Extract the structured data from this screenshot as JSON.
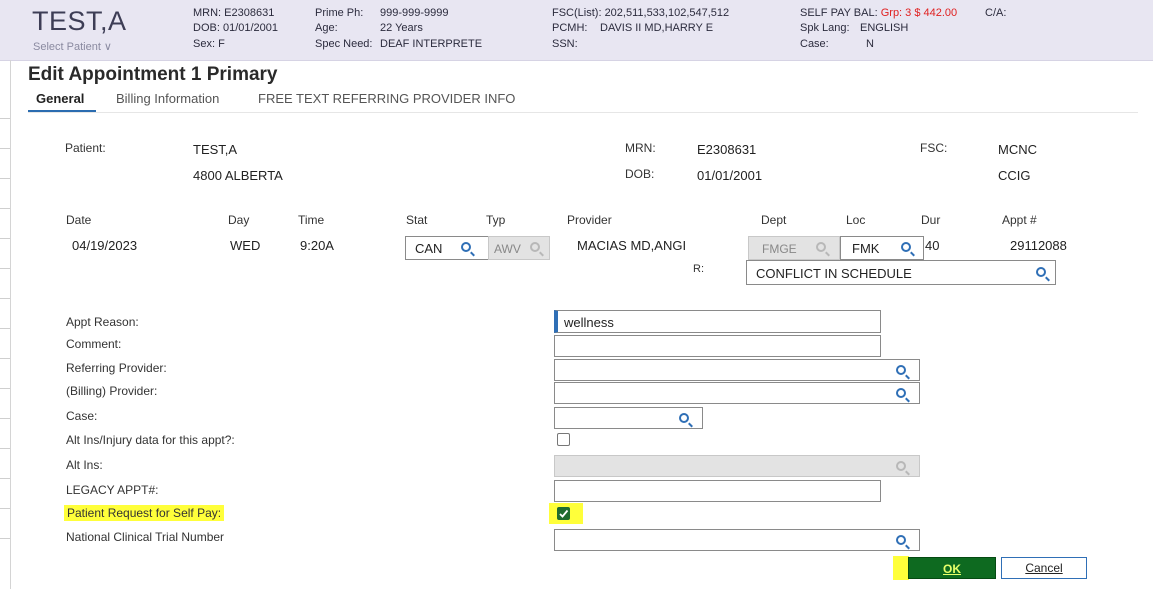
{
  "header": {
    "patient_name": "TEST,A",
    "select_patient": "Select Patient ∨",
    "mrn_label": "MRN:",
    "mrn": "E2308631",
    "dob_label": "DOB:",
    "dob": "01/01/2001",
    "sex_label": "Sex:",
    "sex": "F",
    "prime_ph_label": "Prime Ph:",
    "prime_ph": "999-999-9999",
    "age_label": "Age:",
    "age": "22 Years",
    "spec_need_label": "Spec Need:",
    "spec_need": "DEAF INTERPRETE",
    "fsc_list_label": "FSC(List):",
    "fsc_list": "202,511,533,102,547,512",
    "pcmh_label": "PCMH:",
    "pcmh": "DAVIS II MD,HARRY E",
    "ssn_label": "SSN:",
    "self_pay_label": "SELF PAY BAL:",
    "self_pay_value": "Grp: 3 $ 442.00",
    "spk_lang_label": "Spk Lang:",
    "spk_lang": "ENGLISH",
    "case_label": "Case:",
    "case": "N",
    "ca_label": "C/A:"
  },
  "page": {
    "title": "Edit Appointment 1 Primary",
    "tabs": [
      "General",
      "Billing Information",
      "FREE TEXT REFERRING PROVIDER INFO"
    ]
  },
  "patient": {
    "label": "Patient:",
    "name": "TEST,A",
    "address": "4800 ALBERTA",
    "mrn_label": "MRN:",
    "mrn": "E2308631",
    "dob_label": "DOB:",
    "dob": "01/01/2001",
    "fsc_label": "FSC:",
    "fsc1": "MCNC",
    "fsc2": "CCIG"
  },
  "appt": {
    "headers": {
      "date": "Date",
      "day": "Day",
      "time": "Time",
      "stat": "Stat",
      "typ": "Typ",
      "provider": "Provider",
      "dept": "Dept",
      "loc": "Loc",
      "dur": "Dur",
      "appt": "Appt #"
    },
    "date": "04/19/2023",
    "day": "WED",
    "time": "9:20A",
    "stat": "CAN",
    "typ": "AWV",
    "provider": "MACIAS MD,ANGI",
    "dept": "FMGE",
    "loc": "FMK",
    "dur": "40",
    "appt_no": "29112088",
    "r_label": "R:",
    "reason_code": "CONFLICT IN SCHEDULE"
  },
  "form": {
    "appt_reason_label": "Appt Reason:",
    "appt_reason_value": "wellness",
    "comment_label": "Comment:",
    "referring_label": "Referring Provider:",
    "billing_label": "(Billing) Provider:",
    "case_label": "Case:",
    "alt_ins_injury_label": "Alt Ins/Injury data for this appt?:",
    "alt_ins_label": "Alt Ins:",
    "legacy_label": "LEGACY APPT#:",
    "self_pay_req_label": "Patient Request for Self Pay:",
    "nct_label": "National Clinical Trial Number",
    "alt_ins_injury_checked": false,
    "self_pay_req_checked": true
  },
  "buttons": {
    "ok": "OK",
    "cancel": "Cancel"
  },
  "colors": {
    "ok_bg": "#0e6a20",
    "highlight": "#ffff3a",
    "accent": "#2f6fb6",
    "alert": "#e02020"
  }
}
